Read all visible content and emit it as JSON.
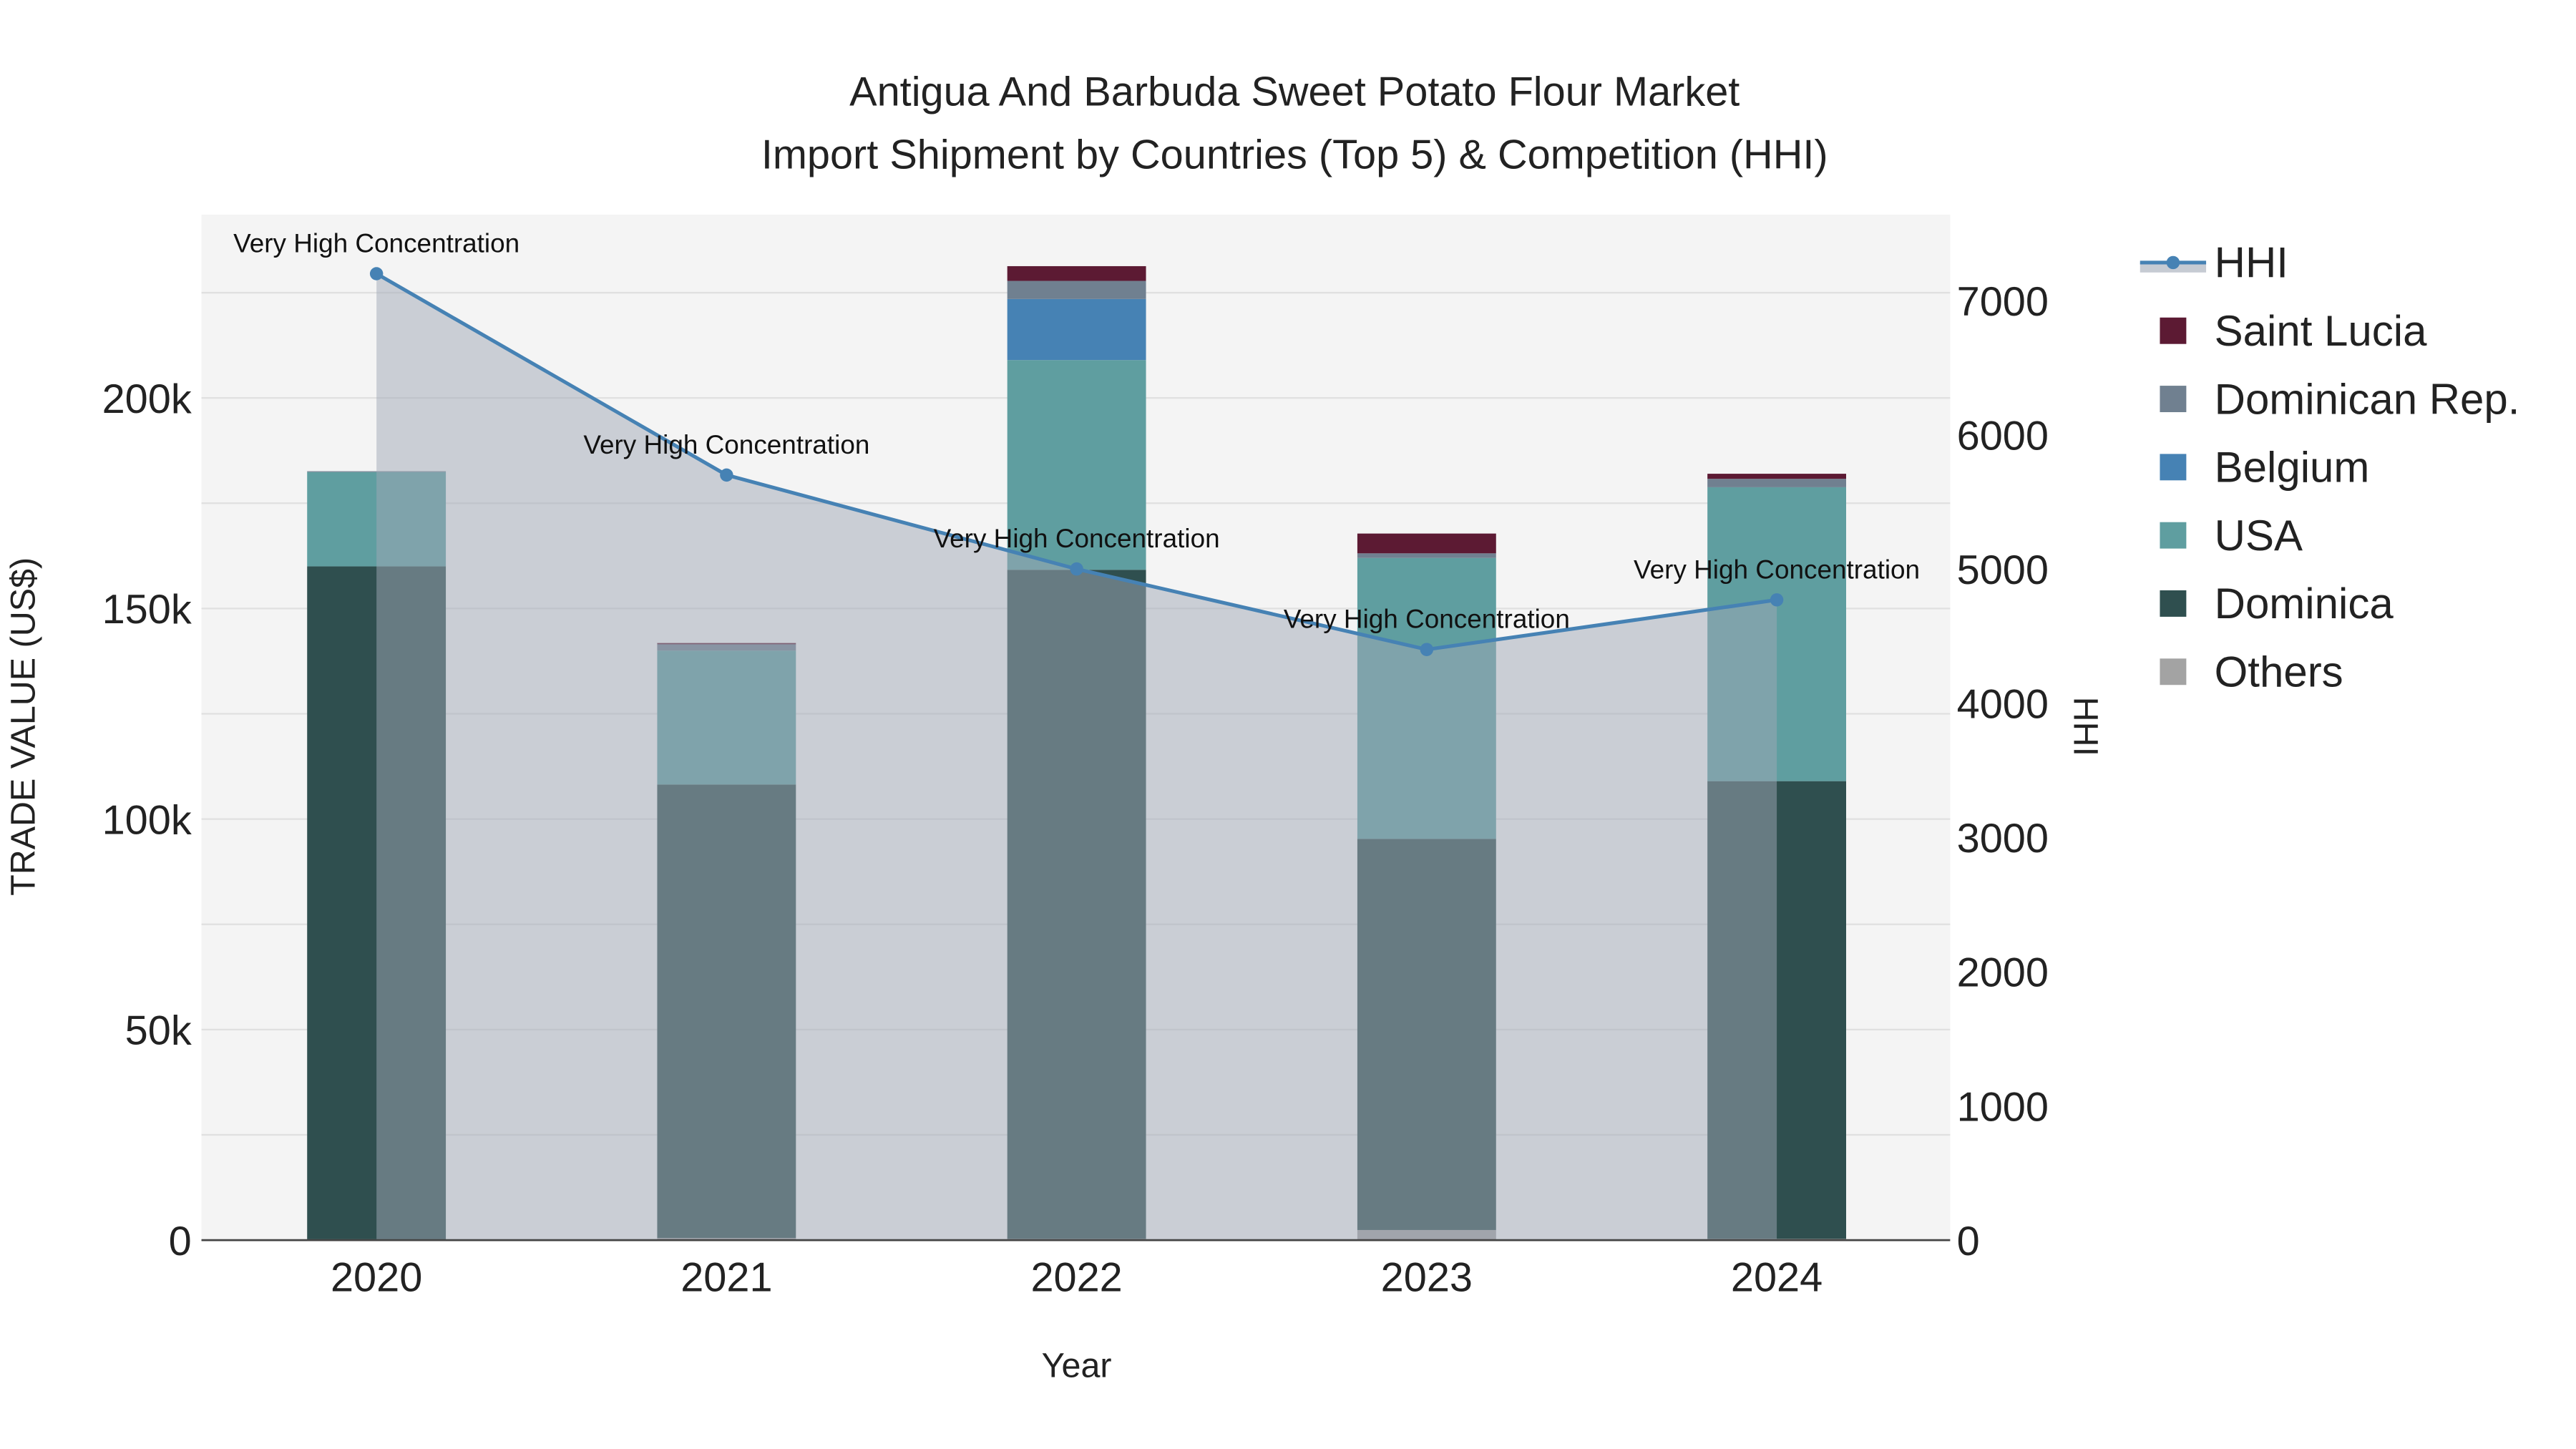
{
  "chart_data": {
    "type": "bar",
    "title": "Antigua And Barbuda Sweet Potato Flour Market",
    "subtitle": "Import Shipment by Countries (Top 5) & Competition (HHI)",
    "xlabel": "Year",
    "ylabel": "TRADE VALUE (US$)",
    "y2label": "HHI",
    "categories": [
      "2020",
      "2021",
      "2022",
      "2023",
      "2024"
    ],
    "ylim": [
      0,
      243000
    ],
    "y2lim": [
      0,
      7600
    ],
    "yticks": [
      0,
      50000,
      100000,
      150000,
      200000
    ],
    "ytick_labels": [
      "0",
      "50k",
      "100k",
      "150k",
      "200k"
    ],
    "y2ticks": [
      0,
      1000,
      2000,
      3000,
      4000,
      5000,
      6000,
      7000
    ],
    "y2tick_labels": [
      "0",
      "1000",
      "2000",
      "3000",
      "4000",
      "5000",
      "6000",
      "7000"
    ],
    "series": [
      {
        "name": "Others",
        "color": "#a3a3a3",
        "values": [
          200,
          500,
          300,
          2400,
          300
        ]
      },
      {
        "name": "Dominica",
        "color": "#2f4f4f",
        "values": [
          159800,
          107700,
          158900,
          92900,
          108700
        ]
      },
      {
        "name": "USA",
        "color": "#5f9ea0",
        "values": [
          22400,
          31800,
          49800,
          66700,
          69800
        ]
      },
      {
        "name": "Belgium",
        "color": "#4682b4",
        "values": [
          0,
          0,
          14500,
          0,
          0
        ]
      },
      {
        "name": "Dominican Rep.",
        "color": "#708090",
        "values": [
          200,
          1500,
          4300,
          1100,
          2000
        ]
      },
      {
        "name": "Saint Lucia",
        "color": "#5c1a33",
        "values": [
          0,
          300,
          3500,
          4700,
          1200
        ]
      }
    ],
    "hhi": {
      "name": "HHI",
      "color": "#4682b4",
      "values": [
        7200,
        5700,
        5000,
        4400,
        4770
      ],
      "annotations": [
        "Very High Concentration",
        "Very High Concentration",
        "Very High Concentration",
        "Very High Concentration",
        "Very High Concentration"
      ]
    },
    "legend_order": [
      "HHI",
      "Saint Lucia",
      "Dominican Rep.",
      "Belgium",
      "USA",
      "Dominica",
      "Others"
    ],
    "legend_position": "right",
    "grid": true
  }
}
